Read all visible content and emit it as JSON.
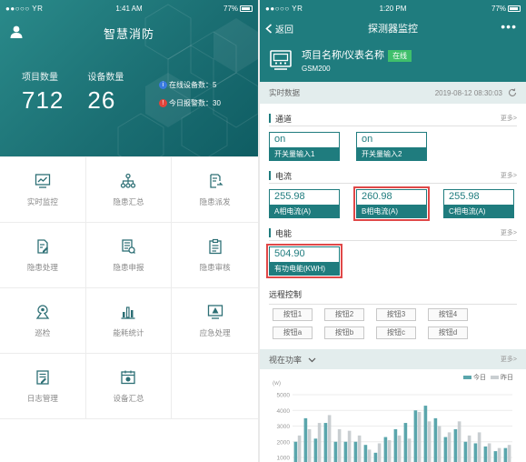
{
  "left": {
    "statusbar": {
      "carrier": "●●○○○ YR",
      "time": "1:41 AM",
      "battery": "77%"
    },
    "title": "智慧消防",
    "stats": [
      {
        "label": "项目数量",
        "value": "712"
      },
      {
        "label": "设备数量",
        "value": "26"
      }
    ],
    "online_label": "在线设备数：5",
    "alarm_label": "今日报警数：30",
    "menu": [
      {
        "label": "实时监控",
        "icon": "monitor-chart-icon"
      },
      {
        "label": "隐患汇总",
        "icon": "hierarchy-icon"
      },
      {
        "label": "隐患派发",
        "icon": "dispatch-icon"
      },
      {
        "label": "隐患处理",
        "icon": "edit-doc-icon"
      },
      {
        "label": "隐患申报",
        "icon": "report-doc-icon"
      },
      {
        "label": "隐患审核",
        "icon": "clipboard-icon"
      },
      {
        "label": "巡检",
        "icon": "patrol-icon"
      },
      {
        "label": "能耗统计",
        "icon": "bar-stats-icon"
      },
      {
        "label": "应急处理",
        "icon": "alarm-monitor-icon"
      },
      {
        "label": "日志管理",
        "icon": "log-icon"
      },
      {
        "label": "设备汇总",
        "icon": "device-summary-icon"
      }
    ],
    "colors": {
      "header": "#1b6f73",
      "icon": "#2d6f75"
    }
  },
  "right": {
    "statusbar": {
      "carrier": "●●○○○ YR",
      "time": "1:20 PM",
      "battery": "77%"
    },
    "back_label": "返回",
    "title": "探测器监控",
    "more": "•••",
    "device_name": "项目名称/仪表名称",
    "status_badge": "在线",
    "device_model": "GSM200",
    "realtime_title": "实时数据",
    "realtime_time": "2019-08-12 08:30:03",
    "more_label": "更多>",
    "sections": [
      {
        "title": "通道",
        "tiles": [
          {
            "value": "on",
            "label": "开关量输入1",
            "highlight": false
          },
          {
            "value": "on",
            "label": "开关量输入2",
            "highlight": false
          }
        ]
      },
      {
        "title": "电流",
        "tiles": [
          {
            "value": "255.98",
            "label": "A相电流(A)",
            "highlight": false
          },
          {
            "value": "260.98",
            "label": "B相电流(A)",
            "highlight": true
          },
          {
            "value": "255.98",
            "label": "C相电流(A)",
            "highlight": false
          }
        ]
      },
      {
        "title": "电能",
        "tiles": [
          {
            "value": "504.90",
            "label": "有功电能(KWH)",
            "highlight": true
          }
        ]
      }
    ],
    "remote_title": "远程控制",
    "buttons": [
      "按钮1",
      "按钮2",
      "按钮3",
      "按钮4",
      "按钮a",
      "按钮b",
      "按钮c",
      "按钮d"
    ],
    "power_title": "视在功率",
    "colors": {
      "accent": "#1f7c7e",
      "online": "#3fbf6b",
      "highlight": "#e04848",
      "today": "#5aa6ac",
      "yesterday": "#c9ced1"
    }
  },
  "chart_data": {
    "type": "bar",
    "unit": "(w)",
    "ylim": [
      1000,
      5000
    ],
    "yticks": [
      "5000",
      "4000",
      "3000",
      "2000",
      "1000"
    ],
    "series": [
      {
        "name": "今日",
        "values": [
          2000,
          3500,
          2200,
          3200,
          2000,
          2000,
          2000,
          1800,
          1300,
          2300,
          2800,
          3200,
          4000,
          4300,
          3500,
          2300,
          2800,
          2000,
          1900,
          1700,
          1400,
          1600
        ]
      },
      {
        "name": "昨日",
        "values": [
          2400,
          2800,
          3200,
          3700,
          2800,
          2700,
          2400,
          1500,
          1900,
          2100,
          2400,
          2200,
          3900,
          3300,
          3000,
          2600,
          3300,
          2400,
          2600,
          1900,
          1600,
          1800
        ]
      }
    ],
    "grid": true,
    "legend": "top-right"
  }
}
